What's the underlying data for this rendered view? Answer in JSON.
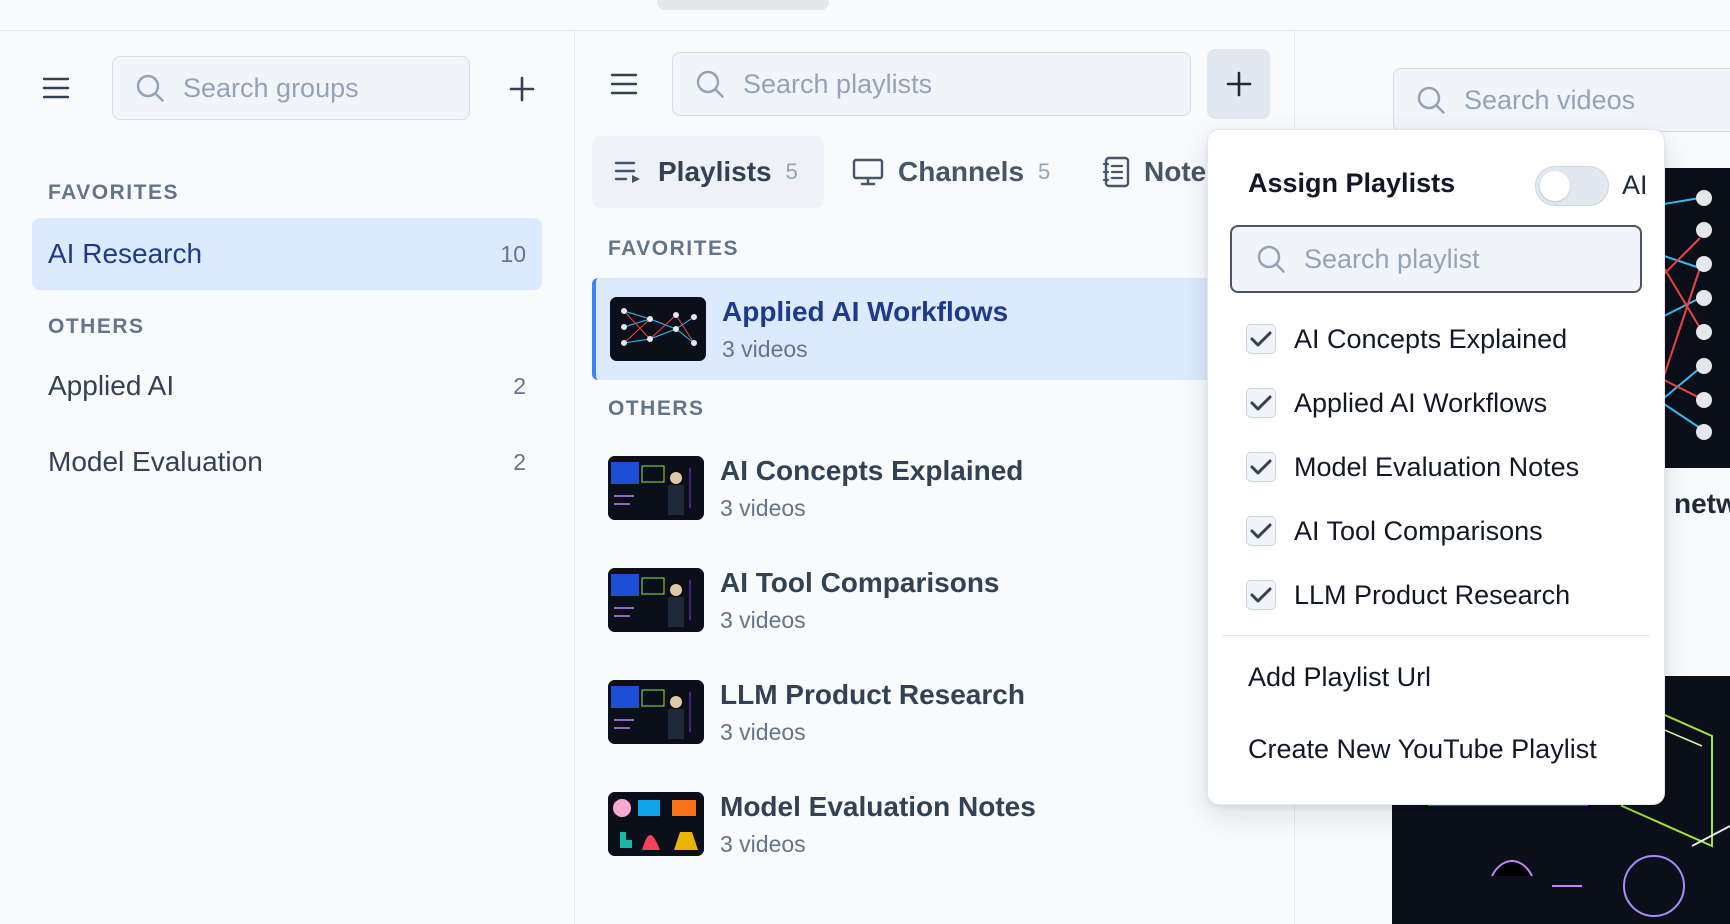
{
  "groups_panel": {
    "search_placeholder": "Search groups",
    "favorites_label": "FAVORITES",
    "others_label": "OTHERS",
    "favorites": [
      {
        "label": "AI Research",
        "count": "10"
      }
    ],
    "others": [
      {
        "label": "Applied AI",
        "count": "2"
      },
      {
        "label": "Model Evaluation",
        "count": "2"
      }
    ]
  },
  "playlists_panel": {
    "search_placeholder": "Search playlists",
    "tabs": [
      {
        "label": "Playlists",
        "count": "5"
      },
      {
        "label": "Channels",
        "count": "5"
      },
      {
        "label": "Note",
        "count": ""
      }
    ],
    "favorites_label": "FAVORITES",
    "others_label": "OTHERS",
    "favorites": [
      {
        "title": "Applied AI Workflows",
        "subtitle": "3 videos"
      }
    ],
    "others": [
      {
        "title": "AI Concepts Explained",
        "subtitle": "3 videos"
      },
      {
        "title": "AI Tool Comparisons",
        "subtitle": "3 videos"
      },
      {
        "title": "LLM Product Research",
        "subtitle": "3 videos"
      },
      {
        "title": "Model Evaluation Notes",
        "subtitle": "3 videos"
      }
    ]
  },
  "videos_panel": {
    "search_placeholder": "Search videos",
    "partial_title": "netw"
  },
  "assign_dropdown": {
    "title": "Assign Playlists",
    "toggle_label": "AI",
    "search_placeholder": "Search playlist",
    "options": [
      {
        "label": "AI Concepts Explained",
        "checked": true
      },
      {
        "label": "Applied AI Workflows",
        "checked": true
      },
      {
        "label": "Model Evaluation Notes",
        "checked": true
      },
      {
        "label": "AI Tool Comparisons",
        "checked": true
      },
      {
        "label": "LLM Product Research",
        "checked": true
      }
    ],
    "add_url_label": "Add Playlist Url",
    "create_label": "Create New YouTube Playlist"
  },
  "colors": {
    "active_bg": "#dbeafe",
    "active_text": "#1e3a8a",
    "accent_border": "#3b82f6"
  }
}
